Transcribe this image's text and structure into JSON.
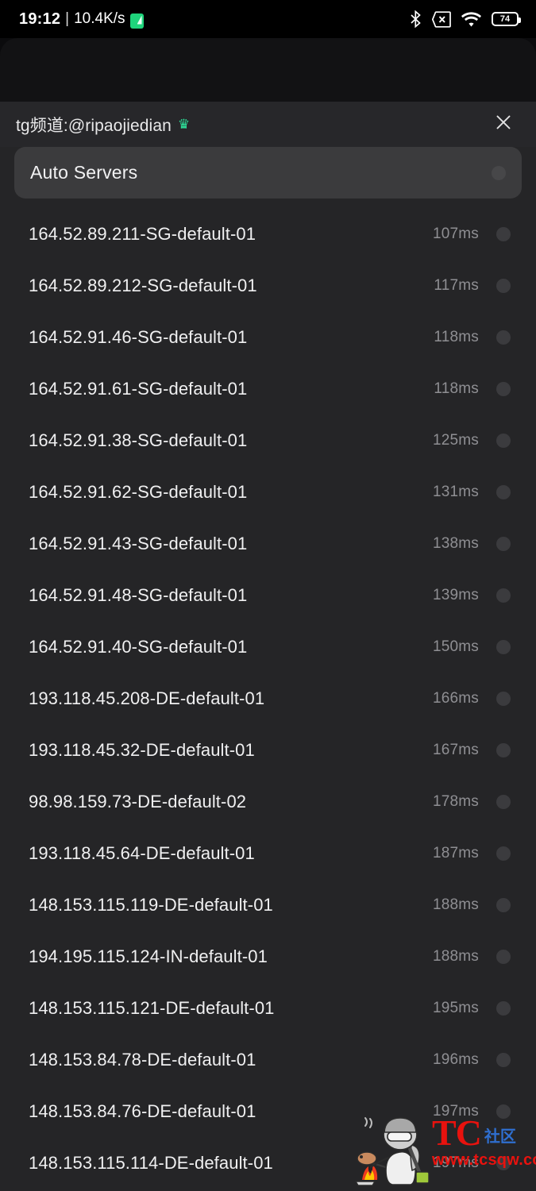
{
  "status_bar": {
    "time": "19:12",
    "separator": "|",
    "net_speed": "10.4K/s",
    "green_app_icon": "green-app-icon",
    "icons": [
      "bluetooth-icon",
      "no-sim-icon",
      "wifi-icon",
      "battery-icon"
    ],
    "battery_level": "74"
  },
  "dialog": {
    "title": "tg频道:@ripaojiedian",
    "crown_icon": "♛",
    "close_icon": "close-icon",
    "auto_servers": {
      "label": "Auto Servers",
      "selected": false
    },
    "servers": [
      {
        "name": "164.52.89.211-SG-default-01",
        "latency": "107ms"
      },
      {
        "name": "164.52.89.212-SG-default-01",
        "latency": "117ms"
      },
      {
        "name": "164.52.91.46-SG-default-01",
        "latency": "118ms"
      },
      {
        "name": "164.52.91.61-SG-default-01",
        "latency": "118ms"
      },
      {
        "name": "164.52.91.38-SG-default-01",
        "latency": "125ms"
      },
      {
        "name": "164.52.91.62-SG-default-01",
        "latency": "131ms"
      },
      {
        "name": "164.52.91.43-SG-default-01",
        "latency": "138ms"
      },
      {
        "name": "164.52.91.48-SG-default-01",
        "latency": "139ms"
      },
      {
        "name": "164.52.91.40-SG-default-01",
        "latency": "150ms"
      },
      {
        "name": "193.118.45.208-DE-default-01",
        "latency": "166ms"
      },
      {
        "name": "193.118.45.32-DE-default-01",
        "latency": "167ms"
      },
      {
        "name": "98.98.159.73-DE-default-02",
        "latency": "178ms"
      },
      {
        "name": "193.118.45.64-DE-default-01",
        "latency": "187ms"
      },
      {
        "name": "148.153.115.119-DE-default-01",
        "latency": "188ms"
      },
      {
        "name": "194.195.115.124-IN-default-01",
        "latency": "188ms"
      },
      {
        "name": "148.153.115.121-DE-default-01",
        "latency": "195ms"
      },
      {
        "name": "148.153.84.78-DE-default-01",
        "latency": "196ms"
      },
      {
        "name": "148.153.84.76-DE-default-01",
        "latency": "197ms"
      },
      {
        "name": "148.153.115.114-DE-default-01",
        "latency": "197ms"
      }
    ]
  },
  "watermark": {
    "brand_main": "TC",
    "brand_sub": "社区",
    "url": "www.tcsqw.com",
    "character_icon": "pubg-cooking-character-icon"
  },
  "colors": {
    "screen_bg": "#0b0b0d",
    "dialog_bg": "#252527",
    "header_bg": "#27272a",
    "card_bg": "#3b3b3d",
    "text_primary": "#f0f0f1",
    "text_secondary": "#8f8f93",
    "crown_green": "#2ee59d",
    "watermark_red": "#e8120e",
    "watermark_blue": "#2f6fd0",
    "net_green": "#1fd47c"
  }
}
